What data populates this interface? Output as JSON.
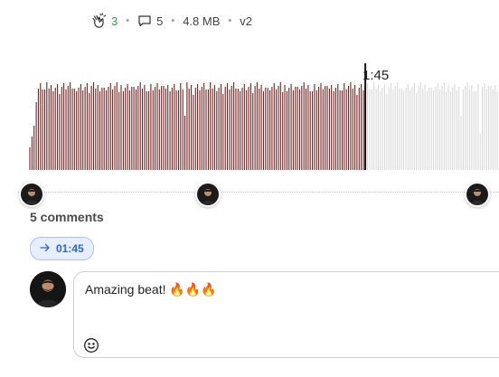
{
  "stats": {
    "claps": "3",
    "comments": "5",
    "size": "4.8 MB",
    "version": "v2",
    "separator": "•"
  },
  "player": {
    "current_time": "1:45",
    "played_fraction": 0.715,
    "played_color": "#7a1f1f",
    "unplayed_color": "#d9d9d9",
    "playhead_color": "#111111"
  },
  "comments_section": {
    "heading": "5 comments",
    "timestamp_chip": "01:45"
  },
  "comment_input": {
    "text": "Amazing beat! 🔥🔥🔥"
  },
  "icons": {
    "clap": "clapping-hands-icon",
    "comment": "speech-bubble-icon",
    "arrow": "arrow-right-icon",
    "emoji": "smiley-icon"
  },
  "colors": {
    "clap_count": "#2e9d4a",
    "chip_text": "#3263c9",
    "chip_bg": "#e7efff"
  }
}
